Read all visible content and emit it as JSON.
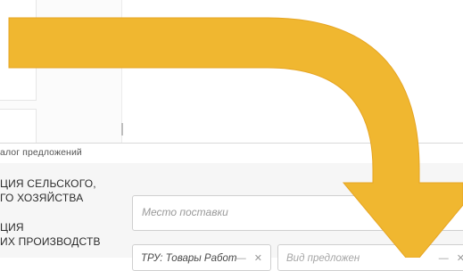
{
  "breadcrumb": "алог предложений",
  "sidebar": {
    "items": [
      {
        "line1": "ЦИЯ СЕЛЬСКОГО,",
        "line2": "ГО ХОЗЯЙСТВА"
      },
      {
        "line1": "ЦИЯ",
        "line2": "ИХ ПРОИЗВОДСТВ"
      }
    ]
  },
  "filters": {
    "delivery_placeholder": "Место поставки",
    "type_selected": "ТРУ: Товары Работ",
    "offer_placeholder": "Вид предложен",
    "select_icons": "— ✕"
  },
  "colors": {
    "arrow": "#f0b730",
    "arrow_outline": "#e6a523"
  }
}
